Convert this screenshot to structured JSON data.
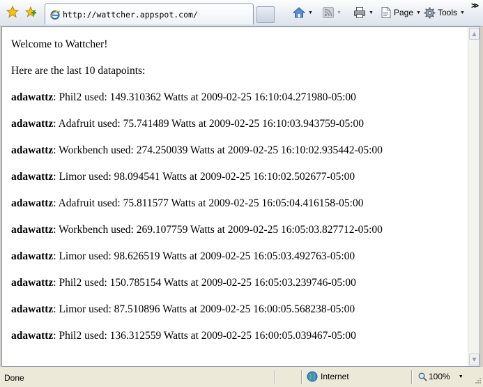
{
  "browser": {
    "tab_title": "http://wattcher.appspot.com/",
    "commands": {
      "page_label": "Page",
      "tools_label": "Tools"
    },
    "status": {
      "text": "Done",
      "zone": "Internet",
      "zoom": "100%"
    }
  },
  "page": {
    "welcome": "Welcome to Wattcher!",
    "intro": "Here are the last 10 datapoints:",
    "datapoints": [
      {
        "user": "adawattz",
        "text": ": Phil2 used: 149.310362 Watts at 2009-02-25 16:10:04.271980-05:00"
      },
      {
        "user": "adawattz",
        "text": ": Adafruit used: 75.741489 Watts at 2009-02-25 16:10:03.943759-05:00"
      },
      {
        "user": "adawattz",
        "text": ": Workbench used: 274.250039 Watts at 2009-02-25 16:10:02.935442-05:00"
      },
      {
        "user": "adawattz",
        "text": ": Limor used: 98.094541 Watts at 2009-02-25 16:10:02.502677-05:00"
      },
      {
        "user": "adawattz",
        "text": ": Adafruit used: 75.811577 Watts at 2009-02-25 16:05:04.416158-05:00"
      },
      {
        "user": "adawattz",
        "text": ": Workbench used: 269.107759 Watts at 2009-02-25 16:05:03.827712-05:00"
      },
      {
        "user": "adawattz",
        "text": ": Limor used: 98.626519 Watts at 2009-02-25 16:05:03.492763-05:00"
      },
      {
        "user": "adawattz",
        "text": ": Phil2 used: 150.785154 Watts at 2009-02-25 16:05:03.239746-05:00"
      },
      {
        "user": "adawattz",
        "text": ": Limor used: 87.510896 Watts at 2009-02-25 16:00:05.568238-05:00"
      },
      {
        "user": "adawattz",
        "text": ": Phil2 used: 136.312559 Watts at 2009-02-25 16:00:05.039467-05:00"
      }
    ]
  }
}
